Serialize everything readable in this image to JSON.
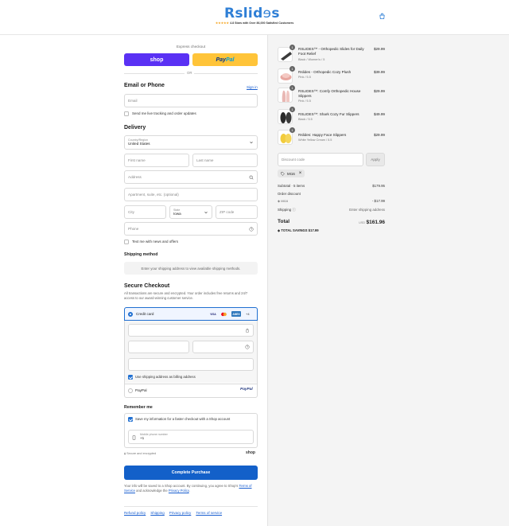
{
  "header": {
    "logo_text": "Rslid",
    "logo_squig": "ɘ",
    "logo_end": "s",
    "tagline_stars": "★★★★★",
    "tagline_text": "4.8 Stars with Over 86,000 Satisfied Customers",
    "cart_icon": "shopping-bag-icon"
  },
  "express": {
    "label": "Express checkout",
    "shop_label": "shop",
    "paypal_part1": "Pay",
    "paypal_part2": "Pal",
    "or_label": "OR"
  },
  "contact": {
    "heading": "Email or Phone",
    "signin_label": "Sign in",
    "email_placeholder": "Email",
    "tracking_label": "Send me live tracking and order updates"
  },
  "delivery": {
    "heading": "Delivery",
    "country_label": "Country/Region",
    "country_value": "United States",
    "first_name_placeholder": "First name",
    "last_name_placeholder": "Last name",
    "address_placeholder": "Address",
    "apartment_placeholder": "Apartment, suite, etc. (optional)",
    "city_placeholder": "City",
    "state_label": "State",
    "state_value": "Iowa",
    "zip_placeholder": "ZIP code",
    "phone_placeholder": "Phone",
    "offers_label": "Text me with news and offers"
  },
  "shipping_method": {
    "heading": "Shipping method",
    "message": "Enter your shipping address to view available shipping methods."
  },
  "payment": {
    "heading": "Secure Checkout",
    "description": "All transactions are secure and encrypted. Your order includes free returns and 24/7 access to our award-winning customer service.",
    "credit_card_label": "Credit card",
    "card_badges": [
      "VISA",
      "MC",
      "AMEX"
    ],
    "more_cards": "+4",
    "billing_label": "Use shipping address as billing address",
    "paypal_label": "PayPal",
    "paypal_logo": "PayPal"
  },
  "remember": {
    "heading": "Remember me",
    "save_label": "Save my information for a faster checkout with a Shop account",
    "mobile_label": "Mobile phone number",
    "mobile_value": "+1",
    "secure_note": "Secure and encrypted",
    "shop_logo": "shop"
  },
  "complete": {
    "button_label": "Complete Purchase",
    "note_line1": "Your info will be saved to a Shop account. By continuing, you agree to Shop's",
    "terms_label": "Terms of Service",
    "note_mid": " and acknowledge the ",
    "privacy_label": "Privacy Policy",
    "note_end": "."
  },
  "footer": {
    "links": [
      "Refund policy",
      "Shipping",
      "Privacy policy",
      "Terms of service"
    ]
  },
  "cart": {
    "items": [
      {
        "qty": "1",
        "name": "RSLIDES™ - Orthopedic Slides for Daily Foot Relief",
        "variant": "Black / Women's / 5",
        "price": "$29.99",
        "color": "#3a3a3a"
      },
      {
        "qty": "1",
        "name": "Rslides - Orthopedic Cozy Plush",
        "variant": "Pink / 5.5",
        "price": "$39.99",
        "color": "#e8a7a0"
      },
      {
        "qty": "1",
        "name": "RSLIDES™: Comfy Orthopedic House Slippers",
        "variant": "Pink / 5.5",
        "price": "$29.99",
        "color": "#e9b7b3"
      },
      {
        "qty": "1",
        "name": "RSLIDES™: Shark Cozy Fur Slippers",
        "variant": "Black / 5.5",
        "price": "$49.99",
        "color": "#2b2b2b"
      },
      {
        "qty": "1",
        "name": "Rslides: Happy Face Slippers",
        "variant": "White Yellow Cream / 5.5",
        "price": "$29.99",
        "color": "#f2cc3d"
      }
    ],
    "discount_placeholder": "Discount code",
    "apply_label": "Apply",
    "applied_code": "MI16",
    "remove_symbol": "×",
    "subtotal_label": "Subtotal · 5 items",
    "subtotal_value": "$179.95",
    "order_discount_label": "Order discount",
    "discount_code_line": "MI16",
    "discount_value": "- $17.99",
    "shipping_label": "Shipping",
    "shipping_value": "Enter shipping address",
    "total_label": "Total",
    "currency": "USD",
    "total_value": "$161.96",
    "savings_label": "TOTAL SAVINGS",
    "savings_value": "$17.99"
  }
}
